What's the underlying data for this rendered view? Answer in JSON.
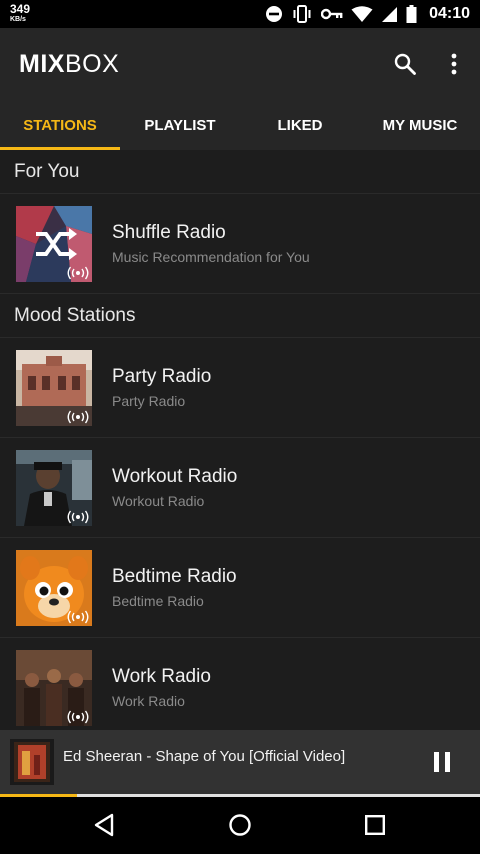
{
  "status_bar": {
    "network_speed": "349",
    "network_unit": "KB/s",
    "icons": [
      "do-not-disturb-icon",
      "vibrate-icon",
      "vpn-key-icon",
      "wifi-icon",
      "signal-icon",
      "battery-icon"
    ],
    "time": "04:10"
  },
  "app_bar": {
    "logo_bold": "MIX",
    "logo_light": "BOX",
    "actions": [
      "search-icon",
      "more-vert-icon"
    ]
  },
  "tabs": [
    {
      "label": "STATIONS",
      "active": true
    },
    {
      "label": "PLAYLIST",
      "active": false
    },
    {
      "label": "LIKED",
      "active": false
    },
    {
      "label": "MY MUSIC",
      "active": false
    }
  ],
  "sections": [
    {
      "title": "For You",
      "items": [
        {
          "title": "Shuffle Radio",
          "subtitle": "Music Recommendation for You"
        }
      ]
    },
    {
      "title": "Mood Stations",
      "items": [
        {
          "title": "Party Radio",
          "subtitle": "Party Radio"
        },
        {
          "title": "Workout Radio",
          "subtitle": "Workout Radio"
        },
        {
          "title": "Bedtime Radio",
          "subtitle": "Bedtime Radio"
        },
        {
          "title": "Work Radio",
          "subtitle": "Work Radio"
        }
      ]
    }
  ],
  "mini_player": {
    "track_title": "Ed Sheeran - Shape of You [Official Video]",
    "progress": 0.16
  },
  "colors": {
    "accent": "#f6b816",
    "background": "#1d1d1d",
    "app_bar": "#262626"
  },
  "nav_bar": [
    "back-icon",
    "home-icon",
    "recents-icon"
  ]
}
